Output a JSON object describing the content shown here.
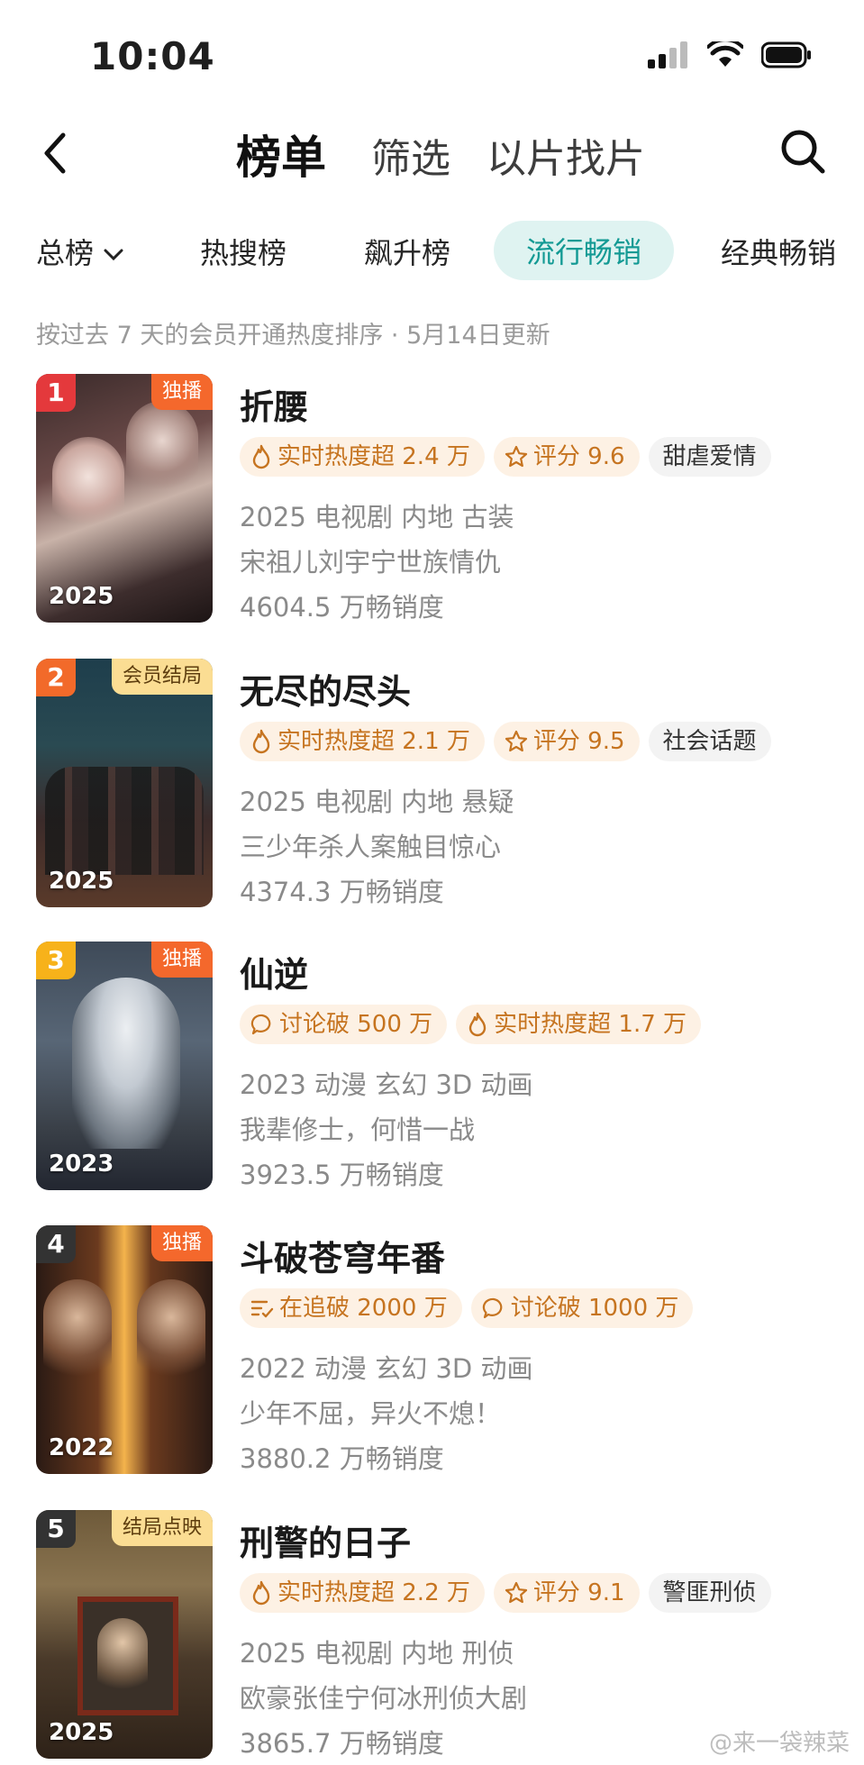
{
  "status": {
    "time": "10:04"
  },
  "nav": {
    "tabs": [
      "榜单",
      "筛选",
      "以片找片"
    ]
  },
  "filters": {
    "items": [
      "总榜",
      "热搜榜",
      "飙升榜",
      "流行畅销",
      "经典畅销"
    ]
  },
  "description": "按过去 7 天的会员开通热度排序 · 5月14日更新",
  "colors": {
    "accent": "#139a94",
    "badge_text": "#c67420",
    "badge_bg": "#fdf1e4"
  },
  "items": [
    {
      "rank": "1",
      "rank_color": "#e4393c",
      "tag": "独播",
      "year": "2025",
      "title": "折腰",
      "badges": [
        {
          "icon": "flame-icon",
          "text": "实时热度超 2.4 万"
        },
        {
          "icon": "star-icon",
          "text": "评分 9.6"
        },
        {
          "icon": "",
          "text": "甜虐爱情"
        }
      ],
      "meta": "2025 电视剧 内地 古装",
      "line2": "宋祖儿刘宇宁世族情仇",
      "line3": "4604.5 万畅销度"
    },
    {
      "rank": "2",
      "rank_color": "#f26a2a",
      "tag": "会员结局",
      "year": "2025",
      "title": "无尽的尽头",
      "badges": [
        {
          "icon": "flame-icon",
          "text": "实时热度超 2.1 万"
        },
        {
          "icon": "star-icon",
          "text": "评分 9.5"
        },
        {
          "icon": "",
          "text": "社会话题"
        }
      ],
      "meta": "2025 电视剧 内地 悬疑",
      "line2": "三少年杀人案触目惊心",
      "line3": "4374.3 万畅销度"
    },
    {
      "rank": "3",
      "rank_color": "#f7b21a",
      "tag": "独播",
      "year": "2023",
      "title": "仙逆",
      "badges": [
        {
          "icon": "chat-icon",
          "text": "讨论破 500 万"
        },
        {
          "icon": "flame-icon",
          "text": "实时热度超 1.7 万"
        }
      ],
      "meta": "2023 动漫 玄幻 3D 动画",
      "line2": "我辈修士，何惜一战",
      "line3": "3923.5 万畅销度"
    },
    {
      "rank": "4",
      "rank_color": "#333333",
      "tag": "独播",
      "year": "2022",
      "title": "斗破苍穹年番",
      "badges": [
        {
          "icon": "list-check-icon",
          "text": "在追破 2000 万"
        },
        {
          "icon": "chat-icon",
          "text": "讨论破 1000 万"
        }
      ],
      "meta": "2022 动漫 玄幻 3D 动画",
      "line2": "少年不屈，异火不熄！",
      "line3": "3880.2 万畅销度"
    },
    {
      "rank": "5",
      "rank_color": "#333333",
      "tag": "结局点映",
      "year": "2025",
      "title": "刑警的日子",
      "badges": [
        {
          "icon": "flame-icon",
          "text": "实时热度超 2.2 万"
        },
        {
          "icon": "star-icon",
          "text": "评分 9.1"
        },
        {
          "icon": "",
          "text": "警匪刑侦"
        }
      ],
      "meta": "2025 电视剧 内地 刑侦",
      "line2": "欧豪张佳宁何冰刑侦大剧",
      "line3": "3865.7 万畅销度"
    }
  ],
  "watermark": "@来一袋辣菜"
}
